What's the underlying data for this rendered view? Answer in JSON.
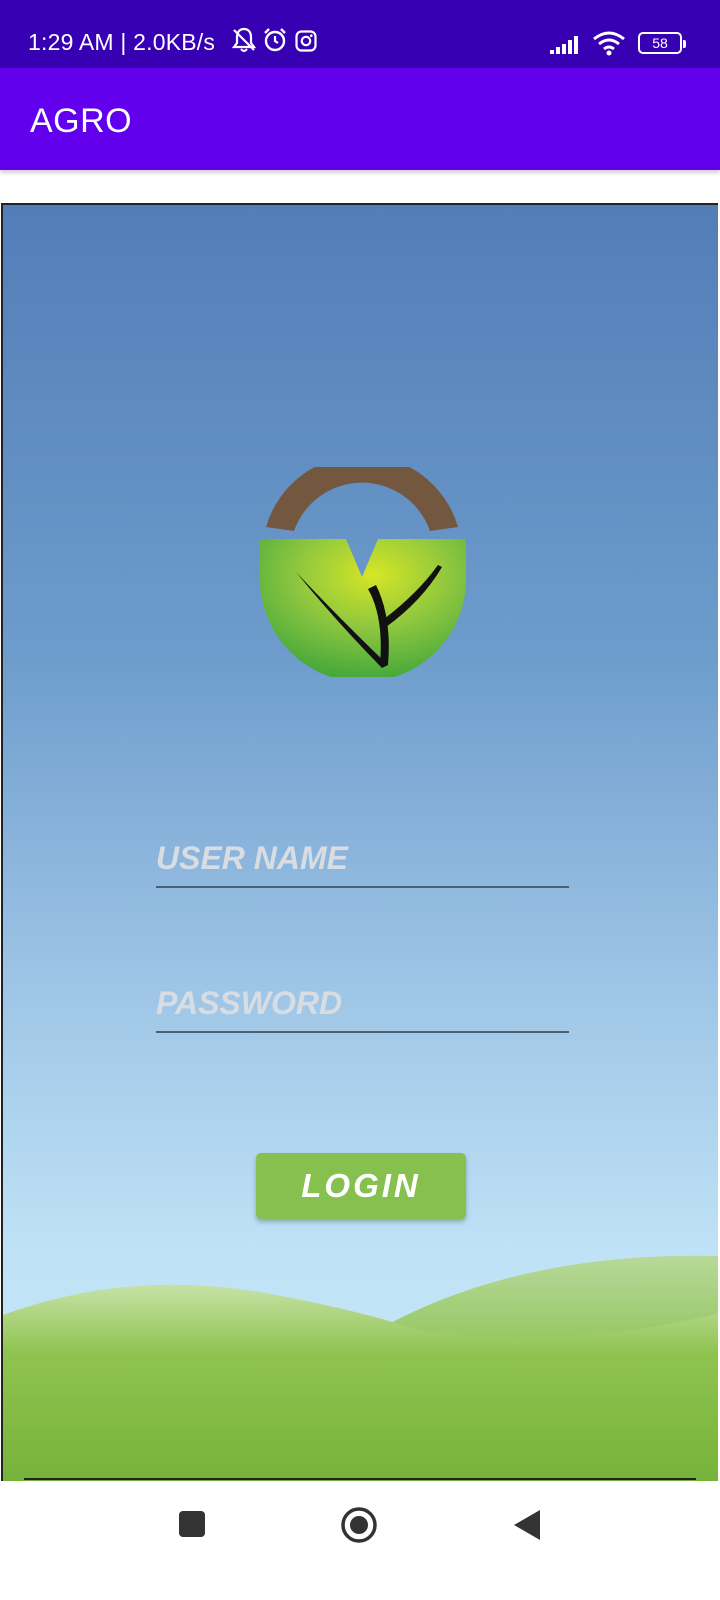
{
  "status_bar": {
    "time_speed": "1:29 AM | 2.0KB/s",
    "battery": "58",
    "icons": [
      "mute-icon",
      "alarm-icon",
      "instagram-icon",
      "signal-icon",
      "wifi-icon",
      "battery-icon"
    ]
  },
  "app_bar": {
    "title": "AGRO"
  },
  "login": {
    "username_placeholder": "USER NAME",
    "password_placeholder": "PASSWORD",
    "login_label": "LOGIN"
  },
  "colors": {
    "status_bar": "#3700b3",
    "app_bar": "#6200ee",
    "login_button": "#86c14f"
  },
  "nav_bar": {
    "buttons": [
      "recents-button",
      "home-button",
      "back-button"
    ]
  }
}
